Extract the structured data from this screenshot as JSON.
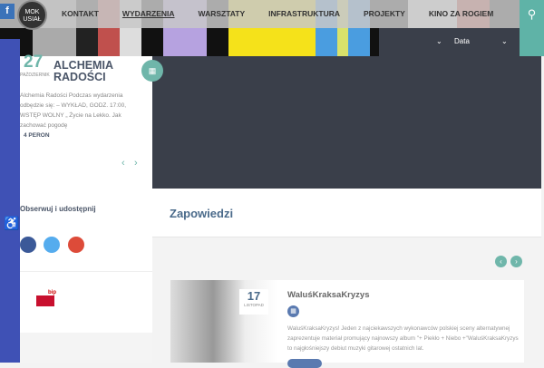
{
  "nav": {
    "logo": "MOK USIAŁ",
    "facebook": "f",
    "items": [
      "KONTAKT",
      "WYDARZENIA",
      "WARSZTATY",
      "INFRASTRUKTURA",
      "PROJEKTY",
      "KINO ZA ROGIEM"
    ]
  },
  "filters": {
    "date_label": "Data"
  },
  "featured": {
    "day": "27",
    "month": "PAŹDZIERNIK",
    "title": "ALCHEMIA RADOŚCI",
    "description": "Alchemia Radości Podczas wydarzenia odbędzie się: – WYKŁAD, GODZ. 17:00, WSTĘP WOLNY „ Życie na Lekko. Jak zachować pogodę",
    "place": "4 PERON"
  },
  "share": {
    "label": "Obserwuj i udostępnij"
  },
  "bip": "bip",
  "section": {
    "title": "Zapowiedzi"
  },
  "event": {
    "day": "17",
    "month": "LISTOPAD",
    "title": "WaluśKraksaKryzys",
    "description": "WaluśKraksaKryzys! Jeden z najciekawszych wykonawców polskiej sceny alternatywnej zaprezentuje materiał promujący najnowszy album \"+ Piekło + Niebo +\"WaluśKraksaKryzys to najgłośniejszy debiut muzyki gitarowej ostatnich lat."
  },
  "colors": {
    "teal": "#6fb6aa",
    "blue_strip": "#3f51b5",
    "dark": "#3a3f4a"
  }
}
